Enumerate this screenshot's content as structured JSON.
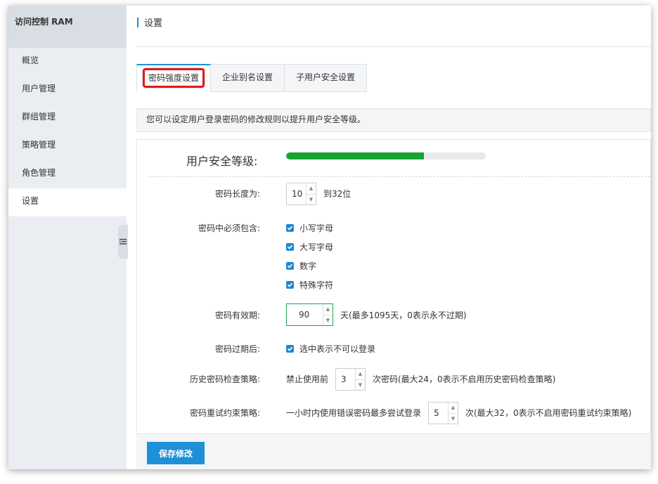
{
  "sidebar": {
    "title": "访问控制 RAM",
    "items": [
      {
        "label": "概览"
      },
      {
        "label": "用户管理"
      },
      {
        "label": "群组管理"
      },
      {
        "label": "策略管理"
      },
      {
        "label": "角色管理"
      },
      {
        "label": "设置"
      }
    ],
    "active_index": 5,
    "collapse_icon": "list-collapse-icon"
  },
  "header": {
    "title": "设置"
  },
  "tabs": [
    {
      "label": "密码强度设置",
      "active": true
    },
    {
      "label": "企业别名设置",
      "active": false
    },
    {
      "label": "子用户安全设置",
      "active": false
    }
  ],
  "notice": "您可以设定用户登录密码的修改规则以提升用户安全等级。",
  "security_level": {
    "label": "用户安全等级:",
    "progress": 0.69,
    "color": "#19a333"
  },
  "password_length": {
    "label": "密码长度为:",
    "value": "10",
    "suffix": "到32位"
  },
  "must_include": {
    "label": "密码中必须包含:",
    "options": [
      {
        "label": "小写字母",
        "checked": true
      },
      {
        "label": "大写字母",
        "checked": true
      },
      {
        "label": "数字",
        "checked": true
      },
      {
        "label": "特殊字符",
        "checked": true
      }
    ]
  },
  "validity": {
    "label": "密码有效期:",
    "value": "90",
    "suffix": "天(最多1095天，0表示永不过期)"
  },
  "after_expiry": {
    "label": "密码过期后:",
    "option": "选中表示不可以登录",
    "checked": true
  },
  "history": {
    "label": "历史密码检查策略:",
    "prefix": "禁止使用前",
    "value": "3",
    "suffix": "次密码(最大24，0表示不启用历史密码检查策略)"
  },
  "retry": {
    "label": "密码重试约束策略:",
    "prefix": "一小时内使用错误密码最多尝试登录",
    "value": "5",
    "suffix": "次(最大32，0表示不启用密码重试约束策略)"
  },
  "save_button": "保存修改",
  "colors": {
    "accent": "#1e90d8",
    "highlight": "#e01919",
    "progress": "#19a333"
  }
}
